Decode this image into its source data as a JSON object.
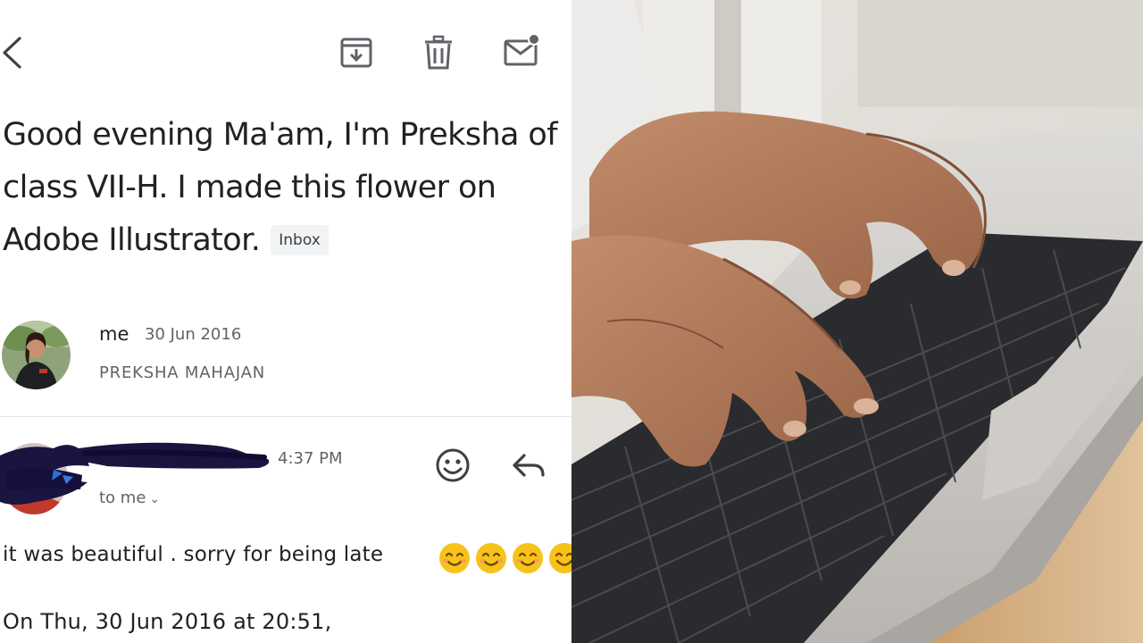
{
  "email": {
    "toolbar": {
      "back_icon": "back-arrow-icon",
      "archive_icon": "archive-icon",
      "delete_icon": "trash-icon",
      "unread_icon": "mark-unread-icon"
    },
    "subject": "Good evening Ma'am, I'm Preksha of class VII-H. I made this flower on Adobe Illustrator.",
    "label": "Inbox",
    "message_1": {
      "sender": "me",
      "date": "30 Jun 2016",
      "recipient": "PREKSHA MAHAJAN"
    },
    "message_2": {
      "time": "4:37 PM",
      "to": "to me",
      "body": "it was beautiful . sorry for being late",
      "emoji_count": 4,
      "quote_header": "On Thu, 30 Jun 2016 at 20:51,"
    },
    "colors": {
      "text": "#202124",
      "secondary_text": "#5f6368",
      "icon": "#5f6368",
      "chip_bg": "#f1f3f4",
      "redaction": "#1a1440"
    }
  },
  "photo": {
    "subject_icon": "hands-typing-on-laptop-keyboard"
  }
}
